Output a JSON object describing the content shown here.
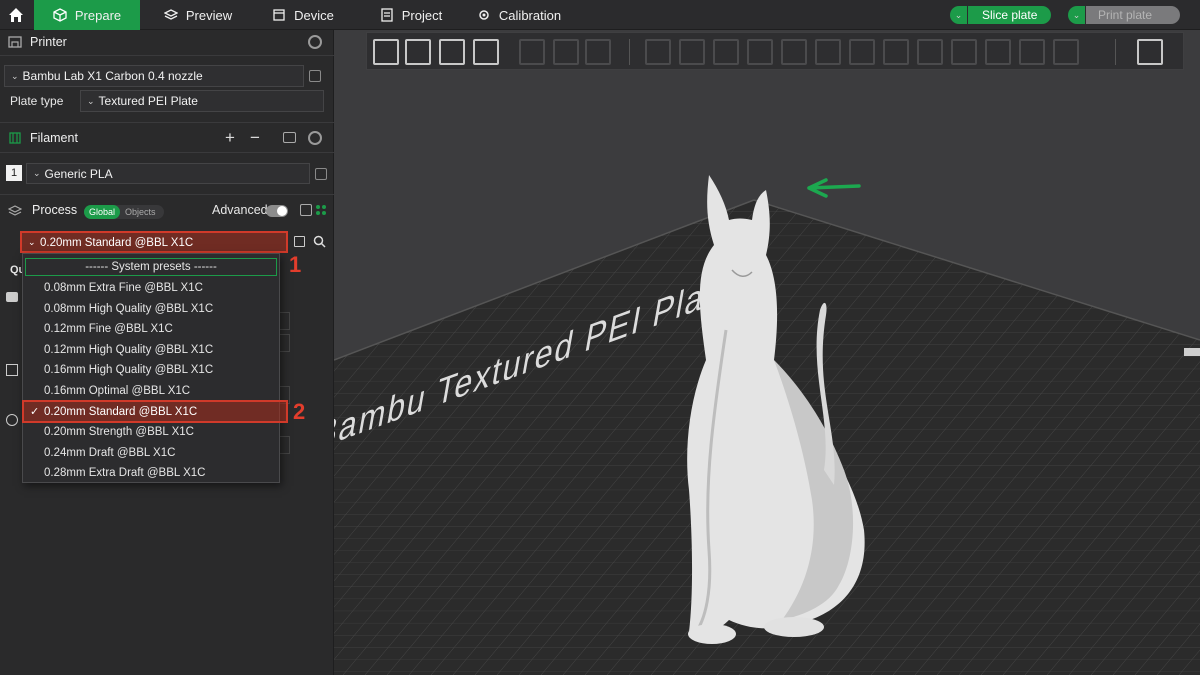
{
  "topbar": {
    "tabs": [
      "Prepare",
      "Preview",
      "Device",
      "Project",
      "Calibration"
    ],
    "slice_label": "Slice plate",
    "print_label": "Print plate"
  },
  "printer": {
    "section_title": "Printer",
    "selected_printer": "Bambu Lab X1 Carbon 0.4 nozzle",
    "plate_type_label": "Plate type",
    "plate_type_value": "Textured PEI Plate"
  },
  "filament": {
    "section_title": "Filament",
    "slot_number": "1",
    "slot_value": "Generic PLA"
  },
  "process": {
    "section_title": "Process",
    "toggle_global": "Global",
    "toggle_objects": "Objects",
    "advanced_label": "Advanced",
    "selected_preset": "0.20mm Standard @BBL X1C"
  },
  "dropdown": {
    "header": "------ System presets ------",
    "items": [
      "0.08mm Extra Fine @BBL X1C",
      "0.08mm High Quality @BBL X1C",
      "0.12mm Fine @BBL X1C",
      "0.12mm High Quality @BBL X1C",
      "0.16mm High Quality @BBL X1C",
      "0.16mm Optimal @BBL X1C",
      "0.20mm Standard @BBL X1C",
      "0.20mm Strength @BBL X1C",
      "0.24mm Draft @BBL X1C",
      "0.28mm Extra Draft @BBL X1C"
    ],
    "checkmark": "✓"
  },
  "annotations": {
    "step1": "1",
    "step2": "2"
  },
  "background_fragments": {
    "tab_partial": "Qu"
  },
  "viewport": {
    "plate_text": "Bambu Textured PEI Plate"
  },
  "colors": {
    "accent": "#1c9b49",
    "highlight": "#d13a2a",
    "panel": "#2a2a2b",
    "bed": "#2c2c2c"
  }
}
